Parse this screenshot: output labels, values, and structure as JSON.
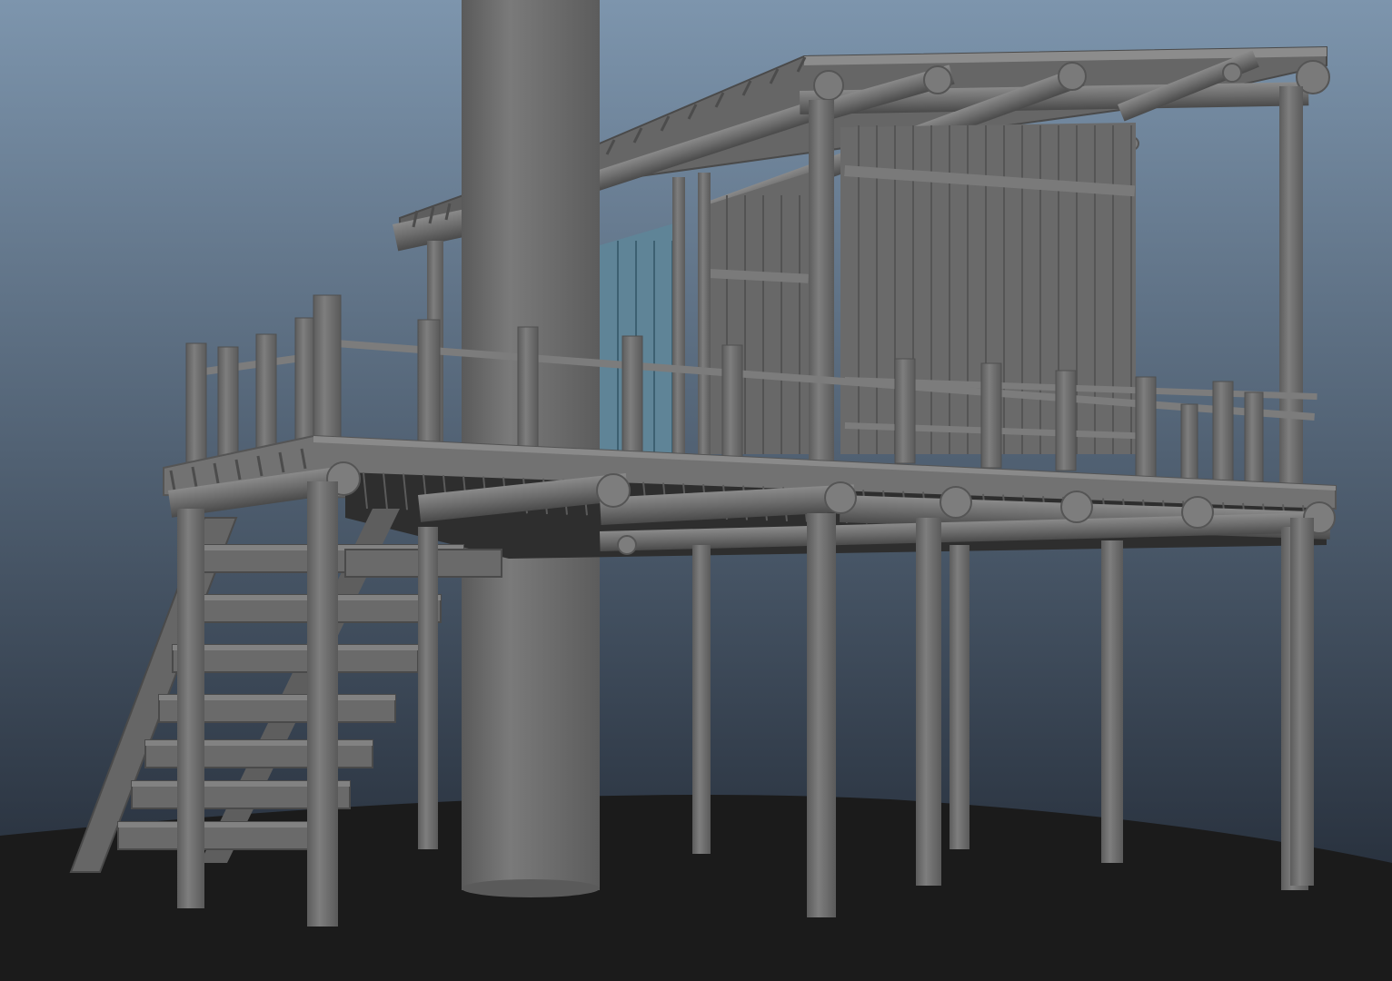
{
  "viewport": {
    "background_top_color": "#7d95ad",
    "background_bottom_color": "#1e2530",
    "ground_color": "#1b1b1b"
  },
  "model": {
    "material_color": "#6f6f6f",
    "material_light": "#8a8a8a",
    "material_dark": "#4e4e4e",
    "window_color": "#5f8497",
    "window_dark": "#3d6071"
  }
}
